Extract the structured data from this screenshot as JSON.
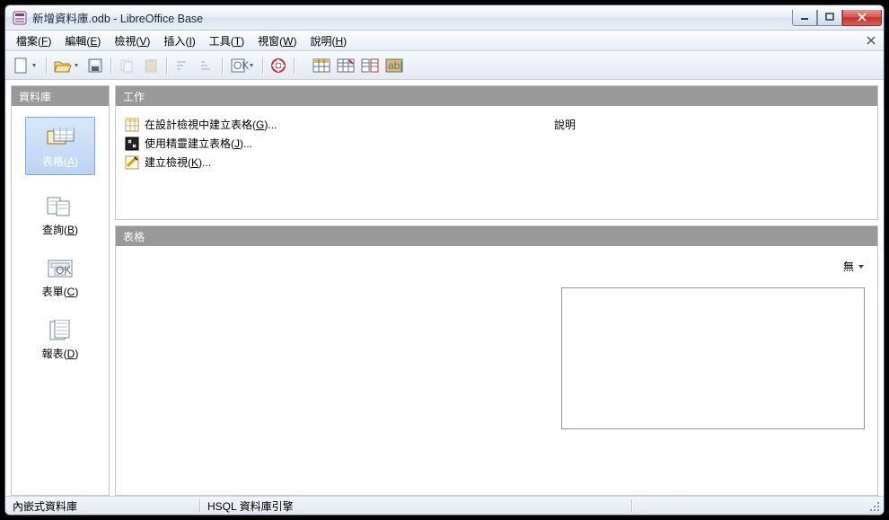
{
  "title": "新增資料庫.odb - LibreOffice Base",
  "menus": [
    {
      "label": "檔案",
      "key": "F"
    },
    {
      "label": "編輯",
      "key": "E"
    },
    {
      "label": "檢視",
      "key": "V"
    },
    {
      "label": "插入",
      "key": "I"
    },
    {
      "label": "工具",
      "key": "T"
    },
    {
      "label": "視窗",
      "key": "W"
    },
    {
      "label": "說明",
      "key": "H"
    }
  ],
  "side_header": "資料庫",
  "side_items": [
    {
      "label": "表格",
      "key": "A",
      "selected": true
    },
    {
      "label": "查詢",
      "key": "B",
      "selected": false
    },
    {
      "label": "表單",
      "key": "C",
      "selected": false
    },
    {
      "label": "報表",
      "key": "D",
      "selected": false
    }
  ],
  "work_header": "工作",
  "tasks": [
    {
      "label": "在設計檢視中建立表格",
      "key": "G",
      "ellipsis": "..."
    },
    {
      "label": "使用精靈建立表格",
      "key": "J",
      "ellipsis": "..."
    },
    {
      "label": "建立檢視",
      "key": "K",
      "ellipsis": "..."
    }
  ],
  "desc_title": "說明",
  "list_header": "表格",
  "view_menu": "無",
  "status": {
    "left": "內嵌式資料庫",
    "mid": "HSQL 資料庫引擎"
  }
}
